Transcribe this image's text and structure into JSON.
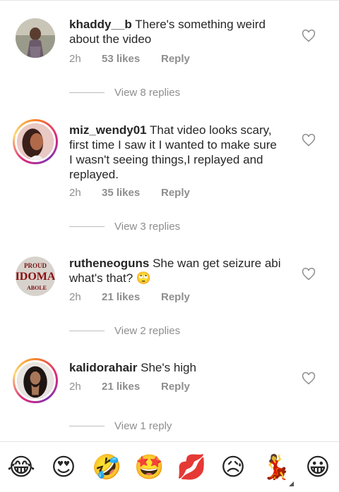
{
  "comments": [
    {
      "username": "khaddy__b",
      "text": "There's something weird about the video",
      "time": "2h",
      "likes": "53 likes",
      "reply": "Reply",
      "view_replies": "View 8 replies"
    },
    {
      "username": "miz_wendy01",
      "text": "That video looks scary, first  time I saw it I wanted to make sure I wasn't seeing things,I replayed and replayed.",
      "time": "2h",
      "likes": "35 likes",
      "reply": "Reply",
      "view_replies": "View 3 replies"
    },
    {
      "username": "rutheneoguns",
      "text": "She wan get seizure abi what's that? 🙄",
      "time": "2h",
      "likes": "21 likes",
      "reply": "Reply",
      "view_replies": "View 2 replies"
    },
    {
      "username": "kalidorahair",
      "text": "She's high",
      "time": "2h",
      "likes": "21 likes",
      "reply": "Reply",
      "view_replies": "View 1 reply"
    }
  ],
  "avatar_badge": {
    "line1": "PROUD",
    "line2": "IDOMA",
    "line3": "ABOLE"
  },
  "emoji_bar": [
    "😂",
    "😍",
    "🤣",
    "🤩",
    "💋",
    "😥",
    "💃",
    "😀"
  ],
  "colors": {
    "username": "#262626",
    "meta": "#8e8e8e",
    "story_ring": "#dd2a7b"
  }
}
